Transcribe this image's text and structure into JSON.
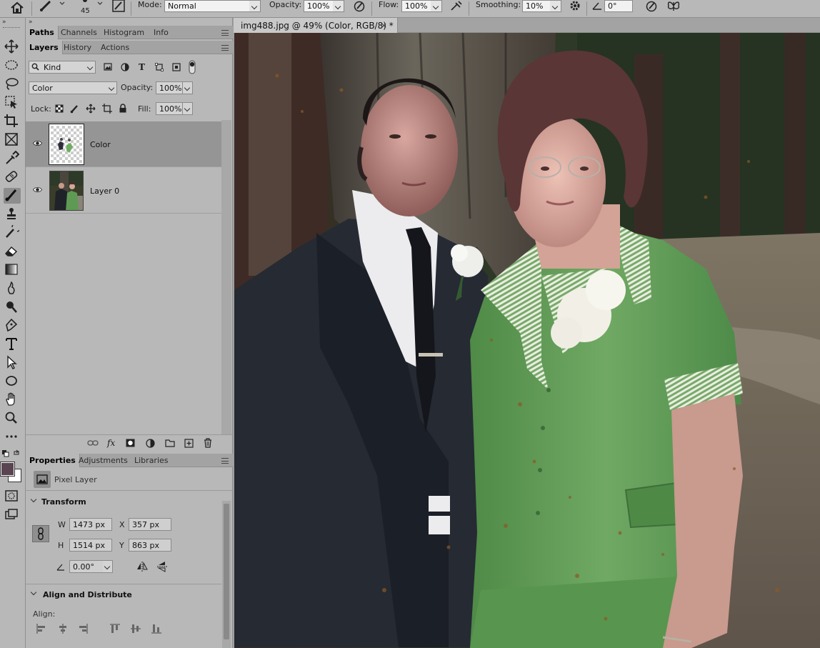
{
  "options_bar": {
    "brush_size": "45",
    "mode_label": "Mode:",
    "mode_value": "Normal",
    "opacity_label": "Opacity:",
    "opacity_value": "100%",
    "flow_label": "Flow:",
    "flow_value": "100%",
    "smoothing_label": "Smoothing:",
    "smoothing_value": "10%",
    "angle_value": "0°"
  },
  "panel_group_top": {
    "tabs": [
      "Paths",
      "Channels",
      "Histogram",
      "Info"
    ]
  },
  "layers_panel": {
    "tabs": [
      "Layers",
      "History",
      "Actions"
    ],
    "filter_kind": "Kind",
    "blend_mode": "Color",
    "opacity_label": "Opacity:",
    "opacity_value": "100%",
    "lock_label": "Lock:",
    "fill_label": "Fill:",
    "fill_value": "100%",
    "layers": [
      {
        "name": "Color",
        "visible": true,
        "selected": true
      },
      {
        "name": "Layer 0",
        "visible": true,
        "selected": false
      }
    ]
  },
  "properties_panel": {
    "tabs": [
      "Properties",
      "Adjustments",
      "Libraries"
    ],
    "kind_label": "Pixel Layer",
    "transform_title": "Transform",
    "w_label": "W",
    "w_value": "1473 px",
    "h_label": "H",
    "h_value": "1514 px",
    "x_label": "X",
    "x_value": "357 px",
    "y_label": "Y",
    "y_value": "863 px",
    "angle_value": "0.00°",
    "align_title": "Align and Distribute",
    "align_label": "Align:"
  },
  "document": {
    "tab_title": "img488.jpg @ 49% (Color, RGB/8) *",
    "close_glyph": "×"
  },
  "colors": {
    "foreground": "#5a4452",
    "background": "#ffffff",
    "ui_panel": "#b8b8b8",
    "selected_row": "#959595"
  },
  "icons": {
    "toolbar": [
      "move-icon",
      "marquee-icon",
      "lasso-icon",
      "object-select-icon",
      "crop-icon",
      "frame-icon",
      "eyedropper-icon",
      "healing-icon",
      "brush-icon",
      "stamp-icon",
      "history-brush-icon",
      "eraser-icon",
      "gradient-icon",
      "smudge-icon",
      "dodge-icon",
      "pen-icon",
      "type-icon",
      "path-select-icon",
      "ellipse-icon",
      "hand-icon",
      "zoom-icon",
      "more-icon"
    ]
  }
}
